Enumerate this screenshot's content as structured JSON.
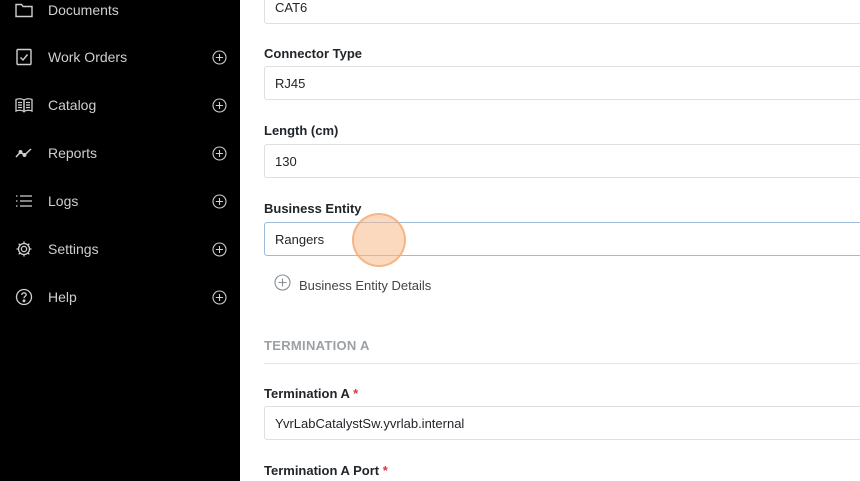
{
  "sidebar": {
    "items": [
      {
        "label": "Documents",
        "icon": "folder-icon",
        "has_add": false
      },
      {
        "label": "Work Orders",
        "icon": "clipboard-check-icon",
        "has_add": true
      },
      {
        "label": "Catalog",
        "icon": "book-icon",
        "has_add": true
      },
      {
        "label": "Reports",
        "icon": "line-chart-icon",
        "has_add": true
      },
      {
        "label": "Logs",
        "icon": "list-icon",
        "has_add": true
      },
      {
        "label": "Settings",
        "icon": "gear-icon",
        "has_add": true
      },
      {
        "label": "Help",
        "icon": "help-circle-icon",
        "has_add": true
      }
    ]
  },
  "form": {
    "cable_type_value": "CAT6",
    "connector_type": {
      "label": "Connector Type",
      "value": "RJ45"
    },
    "length": {
      "label": "Length (cm)",
      "value": "130"
    },
    "business_entity": {
      "label": "Business Entity",
      "value": "Rangers"
    },
    "business_entity_details_label": "Business Entity Details",
    "termination_a_section": "TERMINATION A",
    "termination_a": {
      "label": "Termination A",
      "required_mark": "*",
      "value": "YvrLabCatalystSw.yvrlab.internal"
    },
    "termination_a_port": {
      "label": "Termination A Port",
      "required_mark": "*"
    }
  },
  "colors": {
    "sidebar_bg": "#000000",
    "sidebar_text": "#cfcfcf",
    "required": "#dc3545",
    "section_title": "#9aa0a6",
    "click_indicator": "#f8ba8a"
  }
}
